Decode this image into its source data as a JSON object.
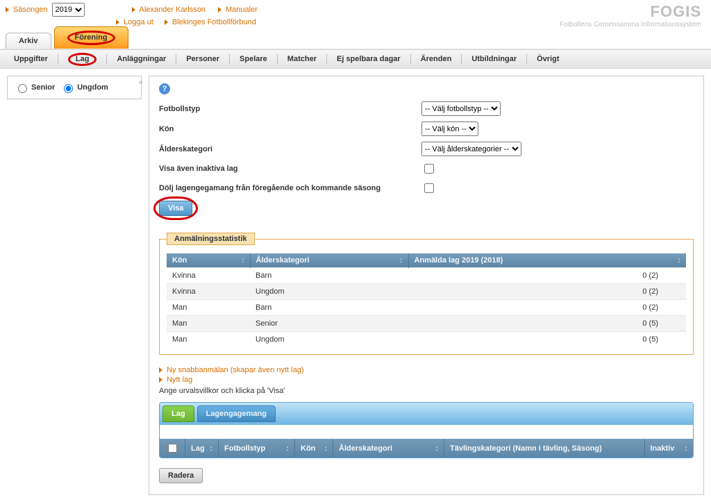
{
  "brand": {
    "title": "FOGIS",
    "subtitle": "Fotbollens Gemensamma Informationssystem"
  },
  "header": {
    "season_label": "Säsongen",
    "season_value": "2019",
    "links": {
      "user": "Alexander Karlsson",
      "manuals": "Manualer",
      "logout": "Logga ut",
      "federation": "Blekinges Fotbollförbund"
    }
  },
  "main_tabs": {
    "archive": "Arkiv",
    "association": "Förening"
  },
  "nav": [
    {
      "key": "uppgifter",
      "label": "Uppgifter"
    },
    {
      "key": "lag",
      "label": "Lag",
      "circled": true
    },
    {
      "key": "anlaggningar",
      "label": "Anläggningar"
    },
    {
      "key": "personer",
      "label": "Personer"
    },
    {
      "key": "spelare",
      "label": "Spelare"
    },
    {
      "key": "matcher",
      "label": "Matcher"
    },
    {
      "key": "ejspelbara",
      "label": "Ej spelbara dagar"
    },
    {
      "key": "arenden",
      "label": "Ärenden"
    },
    {
      "key": "utbildningar",
      "label": "Utbildningar"
    },
    {
      "key": "ovrigt",
      "label": "Övrigt"
    }
  ],
  "sidebar": {
    "senior": "Senior",
    "ungdom": "Ungdom",
    "selected": "ungdom",
    "collapse": "«"
  },
  "filters": {
    "fotbollstyp_label": "Fotbollstyp",
    "fotbollstyp_placeholder": "-- Välj fotbollstyp --",
    "kon_label": "Kön",
    "kon_placeholder": "-- Välj kön --",
    "alder_label": "Ålderskategori",
    "alder_placeholder": "-- Välj ålderskategorier --",
    "inactive_label": "Visa även inaktiva lag",
    "hide_label": "Dölj lagengegamang från föregående och kommande säsong",
    "visa": "Visa"
  },
  "stats": {
    "legend": "Anmälningsstatistik",
    "headers": {
      "kon": "Kön",
      "alder": "Ålderskategori",
      "anmalda": "Anmälda lag 2019 (2018)"
    },
    "rows": [
      {
        "kon": "Kvinna",
        "alder": "Barn",
        "val": "0 (2)"
      },
      {
        "kon": "Kvinna",
        "alder": "Ungdom",
        "val": "0 (2)"
      },
      {
        "kon": "Man",
        "alder": "Barn",
        "val": "0 (2)"
      },
      {
        "kon": "Man",
        "alder": "Senior",
        "val": "0 (5)"
      },
      {
        "kon": "Man",
        "alder": "Ungdom",
        "val": "0 (5)"
      }
    ]
  },
  "links": {
    "quick": "Ny snabbanmälan (skapar även nytt lag)",
    "newteam": "Nytt lag",
    "instruction": "Ange urvalsvillkor och klicka på 'Visa'"
  },
  "lower_tabs": {
    "lag": "Lag",
    "engagemang": "Lagengagemang"
  },
  "lower_grid_headers": {
    "lag": "Lag",
    "fotbollstyp": "Fotbollstyp",
    "kon": "Kön",
    "alder": "Ålderskategori",
    "tavling": "Tävlingskategori (Namn i tävling, Säsong)",
    "inaktiv": "Inaktiv"
  },
  "buttons": {
    "radera": "Radera"
  },
  "help_tooltip": "?"
}
